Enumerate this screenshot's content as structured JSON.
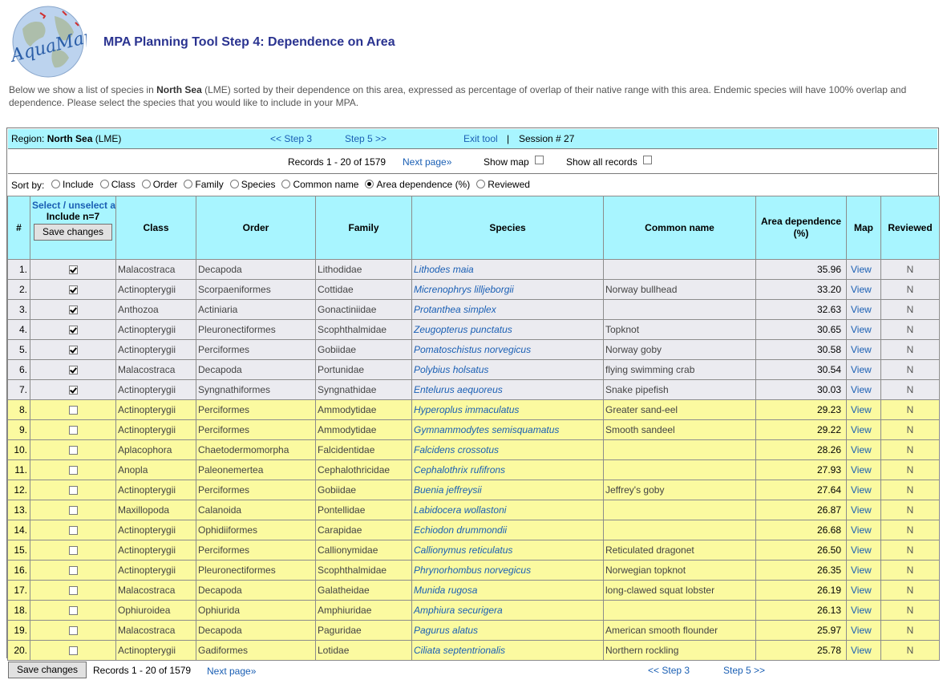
{
  "header": {
    "logo_text": "AquaMaps",
    "title": "MPA Planning Tool Step 4: Dependence on Area"
  },
  "intro": {
    "part1": "Below we show a list of species in ",
    "region": "North Sea",
    "part2": " (LME) sorted by their dependence on this area, expressed as percentage of overlap of their native range with this area. Endemic species will have 100% overlap and dependence. Please select the species that you would like to include in your MPA."
  },
  "region_bar": {
    "label": "Region:",
    "region": "North Sea",
    "suffix": "(LME)",
    "prev_step": "<< Step 3",
    "next_step": "Step 5 >>",
    "exit": "Exit tool",
    "separator": "|",
    "session": "Session # 27"
  },
  "records_bar": {
    "records": "Records 1 - 20 of",
    "total": "1579",
    "next_page": "Next page»",
    "show_map": "Show map",
    "show_all": "Show all records"
  },
  "sort_bar": {
    "label": "Sort by:",
    "options": [
      "Include",
      "Class",
      "Order",
      "Family",
      "Species",
      "Common name",
      "Area dependence (%)",
      "Reviewed"
    ],
    "selected": "Area dependence (%)"
  },
  "table": {
    "headers": {
      "num": "#",
      "select_all": "Select / unselect all",
      "include": "Include n=7",
      "save": "Save changes",
      "class": "Class",
      "order": "Order",
      "family": "Family",
      "species": "Species",
      "common": "Common name",
      "area": "Area dependence (%)",
      "map": "Map",
      "reviewed": "Reviewed"
    },
    "rows": [
      {
        "n": "1.",
        "inc": true,
        "class": "Malacostraca",
        "order": "Decapoda",
        "family": "Lithodidae",
        "species": "Lithodes maia",
        "common": "",
        "dep": "35.96",
        "map": "View",
        "rev": "N"
      },
      {
        "n": "2.",
        "inc": true,
        "class": "Actinopterygii",
        "order": "Scorpaeniformes",
        "family": "Cottidae",
        "species": "Micrenophrys lilljeborgii",
        "common": "Norway bullhead",
        "dep": "33.20",
        "map": "View",
        "rev": "N"
      },
      {
        "n": "3.",
        "inc": true,
        "class": "Anthozoa",
        "order": "Actiniaria",
        "family": "Gonactiniidae",
        "species": "Protanthea simplex",
        "common": "",
        "dep": "32.63",
        "map": "View",
        "rev": "N"
      },
      {
        "n": "4.",
        "inc": true,
        "class": "Actinopterygii",
        "order": "Pleuronectiformes",
        "family": "Scophthalmidae",
        "species": "Zeugopterus punctatus",
        "common": "Topknot",
        "dep": "30.65",
        "map": "View",
        "rev": "N"
      },
      {
        "n": "5.",
        "inc": true,
        "class": "Actinopterygii",
        "order": "Perciformes",
        "family": "Gobiidae",
        "species": "Pomatoschistus norvegicus",
        "common": "Norway goby",
        "dep": "30.58",
        "map": "View",
        "rev": "N"
      },
      {
        "n": "6.",
        "inc": true,
        "class": "Malacostraca",
        "order": "Decapoda",
        "family": "Portunidae",
        "species": "Polybius holsatus",
        "common": "flying swimming crab",
        "dep": "30.54",
        "map": "View",
        "rev": "N"
      },
      {
        "n": "7.",
        "inc": true,
        "class": "Actinopterygii",
        "order": "Syngnathiformes",
        "family": "Syngnathidae",
        "species": "Entelurus aequoreus",
        "common": "Snake pipefish",
        "dep": "30.03",
        "map": "View",
        "rev": "N"
      },
      {
        "n": "8.",
        "inc": false,
        "class": "Actinopterygii",
        "order": "Perciformes",
        "family": "Ammodytidae",
        "species": "Hyperoplus immaculatus",
        "common": "Greater sand-eel",
        "dep": "29.23",
        "map": "View",
        "rev": "N"
      },
      {
        "n": "9.",
        "inc": false,
        "class": "Actinopterygii",
        "order": "Perciformes",
        "family": "Ammodytidae",
        "species": "Gymnammodytes semisquamatus",
        "common": "Smooth sandeel",
        "dep": "29.22",
        "map": "View",
        "rev": "N"
      },
      {
        "n": "10.",
        "inc": false,
        "class": "Aplacophora",
        "order": "Chaetodermomorpha",
        "family": "Falcidentidae",
        "species": "Falcidens crossotus",
        "common": "",
        "dep": "28.26",
        "map": "View",
        "rev": "N"
      },
      {
        "n": "11.",
        "inc": false,
        "class": "Anopla",
        "order": "Paleonemertea",
        "family": "Cephalothricidae",
        "species": "Cephalothrix rufifrons",
        "common": "",
        "dep": "27.93",
        "map": "View",
        "rev": "N"
      },
      {
        "n": "12.",
        "inc": false,
        "class": "Actinopterygii",
        "order": "Perciformes",
        "family": "Gobiidae",
        "species": "Buenia jeffreysii",
        "common": "Jeffrey's goby",
        "dep": "27.64",
        "map": "View",
        "rev": "N"
      },
      {
        "n": "13.",
        "inc": false,
        "class": "Maxillopoda",
        "order": "Calanoida",
        "family": "Pontellidae",
        "species": "Labidocera wollastoni",
        "common": "",
        "dep": "26.87",
        "map": "View",
        "rev": "N"
      },
      {
        "n": "14.",
        "inc": false,
        "class": "Actinopterygii",
        "order": "Ophidiiformes",
        "family": "Carapidae",
        "species": "Echiodon drummondii",
        "common": "",
        "dep": "26.68",
        "map": "View",
        "rev": "N"
      },
      {
        "n": "15.",
        "inc": false,
        "class": "Actinopterygii",
        "order": "Perciformes",
        "family": "Callionymidae",
        "species": "Callionymus reticulatus",
        "common": "Reticulated dragonet",
        "dep": "26.50",
        "map": "View",
        "rev": "N"
      },
      {
        "n": "16.",
        "inc": false,
        "class": "Actinopterygii",
        "order": "Pleuronectiformes",
        "family": "Scophthalmidae",
        "species": "Phrynorhombus norvegicus",
        "common": "Norwegian topknot",
        "dep": "26.35",
        "map": "View",
        "rev": "N"
      },
      {
        "n": "17.",
        "inc": false,
        "class": "Malacostraca",
        "order": "Decapoda",
        "family": "Galatheidae",
        "species": "Munida rugosa",
        "common": "long-clawed squat lobster",
        "dep": "26.19",
        "map": "View",
        "rev": "N"
      },
      {
        "n": "18.",
        "inc": false,
        "class": "Ophiuroidea",
        "order": "Ophiurida",
        "family": "Amphiuridae",
        "species": "Amphiura securigera",
        "common": "",
        "dep": "26.13",
        "map": "View",
        "rev": "N"
      },
      {
        "n": "19.",
        "inc": false,
        "class": "Malacostraca",
        "order": "Decapoda",
        "family": "Paguridae",
        "species": "Pagurus alatus",
        "common": "American smooth flounder",
        "dep": "25.97",
        "map": "View",
        "rev": "N"
      },
      {
        "n": "20.",
        "inc": false,
        "class": "Actinopterygii",
        "order": "Gadiformes",
        "family": "Lotidae",
        "species": "Ciliata septentrionalis",
        "common": "Northern rockling",
        "dep": "25.78",
        "map": "View",
        "rev": "N"
      }
    ]
  },
  "footer": {
    "save": "Save changes",
    "records": "Records 1 - 20 of",
    "total": "1579",
    "next_page": "Next page»",
    "prev_step": "<< Step 3",
    "next_step": "Step 5 >>"
  },
  "colors": {
    "header_cyan": "#a8f5ff",
    "included_row": "#ebebf0",
    "excluded_row": "#fbfaa0",
    "link_blue": "#1a5fb4",
    "title_navy": "#2a3390"
  }
}
